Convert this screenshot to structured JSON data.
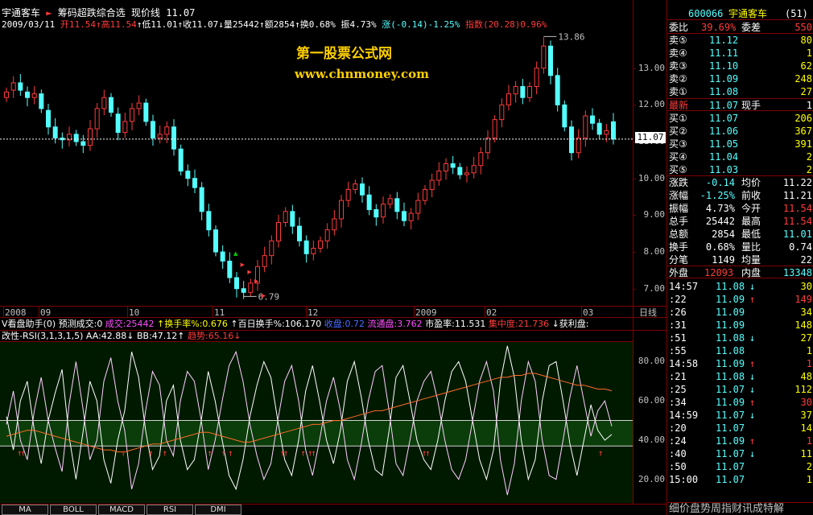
{
  "header": {
    "stock_name": "宇通客车",
    "indicator_name": "筹码超跌综合选",
    "line_type": "现价线",
    "line_value": "11.07",
    "date": "2009/03/11",
    "open": "开11.54",
    "high": "高11.54",
    "low": "低11.01",
    "close": "收11.07",
    "volume": "量25442",
    "amount": "额2854",
    "turnover": "换0.68%",
    "amplitude": "振4.73%",
    "change": "涨(-0.14)-1.25%",
    "index": "指数(20.28)0.96%"
  },
  "watermark": {
    "title": "第一股票公式网",
    "url": "www.chnmoney.com"
  },
  "chart_data": [
    {
      "type": "candlestick",
      "title": "",
      "ylim": [
        6.6,
        14.0
      ],
      "y_ticks": [
        "13.00",
        "12.00",
        "11.00",
        "10.00",
        "9.00",
        "8.00",
        "7.00"
      ],
      "x_ticks": [
        "2008",
        "09",
        "10",
        "11",
        "12",
        "2009",
        "02",
        "03"
      ],
      "period": "日线",
      "annotations": [
        {
          "label": "13.86",
          "value": 13.86
        },
        {
          "label": "6.79",
          "value": 6.79
        }
      ],
      "current_price": {
        "label": "11.07",
        "value": 11.07
      },
      "close": [
        12.35,
        12.6,
        12.4,
        12.2,
        12.3,
        11.9,
        11.4,
        11.1,
        11.05,
        11.2,
        11.0,
        10.9,
        11.35,
        11.9,
        12.2,
        11.8,
        11.25,
        11.55,
        11.9,
        12.05,
        11.55,
        11.1,
        11.2,
        11.4,
        10.8,
        10.2,
        10.0,
        9.75,
        9.1,
        8.6,
        8.0,
        7.75,
        7.3,
        7.0,
        6.9,
        7.15,
        7.6,
        7.9,
        8.3,
        8.8,
        9.1,
        8.7,
        8.3,
        7.95,
        8.1,
        8.3,
        8.6,
        8.9,
        9.4,
        9.7,
        9.85,
        9.55,
        9.15,
        8.95,
        9.3,
        9.45,
        9.1,
        8.85,
        9.05,
        9.4,
        9.7,
        9.95,
        10.2,
        10.4,
        10.3,
        10.1,
        10.15,
        10.35,
        10.7,
        11.1,
        11.6,
        12.0,
        12.3,
        12.5,
        12.2,
        12.5,
        13.0,
        13.6,
        12.8,
        12.0,
        11.4,
        10.7,
        11.1,
        11.7,
        11.5,
        11.2,
        11.3,
        11.07
      ],
      "open": [
        12.2,
        12.4,
        12.6,
        12.35,
        12.2,
        12.3,
        11.85,
        11.4,
        11.1,
        11.05,
        11.2,
        11.0,
        10.9,
        11.35,
        11.9,
        12.2,
        11.75,
        11.25,
        11.55,
        11.9,
        12.05,
        11.55,
        11.1,
        11.2,
        11.4,
        10.8,
        10.2,
        10.0,
        9.75,
        9.1,
        8.6,
        8.0,
        7.75,
        7.3,
        7.0,
        6.9,
        7.15,
        7.6,
        7.9,
        8.3,
        8.8,
        9.1,
        8.7,
        8.3,
        7.95,
        8.1,
        8.3,
        8.6,
        8.9,
        9.4,
        9.7,
        9.85,
        9.55,
        9.15,
        8.95,
        9.3,
        9.45,
        9.1,
        8.85,
        9.05,
        9.4,
        9.7,
        9.95,
        10.2,
        10.4,
        10.3,
        10.1,
        10.15,
        10.35,
        10.7,
        11.1,
        11.6,
        12.0,
        12.3,
        12.5,
        12.2,
        12.5,
        13.0,
        13.6,
        12.8,
        12.0,
        11.4,
        10.7,
        11.1,
        11.7,
        11.5,
        11.2,
        11.54
      ]
    },
    {
      "type": "line",
      "title": "改性-RSI(3,1,3,1,5)",
      "ylim": [
        8,
        90
      ],
      "y_ticks": [
        "80.00",
        "60.00",
        "40.00",
        "20.00"
      ],
      "band": [
        37,
        50
      ],
      "legend_text": [
        "AA:42.88↓",
        "BB:47.12↑",
        "趋势:65.16↓"
      ],
      "series": [
        {
          "name": "AA",
          "values": [
            52,
            35,
            60,
            70,
            45,
            28,
            50,
            64,
            76,
            42,
            20,
            44,
            70,
            60,
            30,
            18,
            40,
            55,
            85,
            72,
            45,
            25,
            32,
            60,
            68,
            40,
            25,
            30,
            50,
            75,
            60,
            40,
            22,
            15,
            30,
            52,
            68,
            80,
            72,
            50,
            30,
            22,
            40,
            65,
            78,
            60,
            40,
            28,
            45,
            70,
            80,
            62,
            40,
            25,
            22,
            45,
            72,
            78,
            60,
            40,
            30,
            25,
            40,
            60,
            75,
            80,
            70,
            50,
            30,
            20,
            35,
            70,
            88,
            72,
            40,
            20,
            30,
            60,
            78,
            80,
            60,
            38,
            22,
            40,
            58,
            45,
            40,
            42.88
          ]
        },
        {
          "name": "BB",
          "values": [
            48,
            65,
            40,
            30,
            55,
            72,
            50,
            36,
            24,
            58,
            80,
            56,
            30,
            40,
            70,
            82,
            60,
            45,
            15,
            28,
            55,
            75,
            68,
            40,
            32,
            60,
            75,
            70,
            50,
            25,
            40,
            60,
            78,
            85,
            70,
            48,
            32,
            20,
            28,
            50,
            70,
            78,
            60,
            35,
            22,
            40,
            60,
            72,
            55,
            30,
            20,
            38,
            60,
            75,
            78,
            55,
            28,
            22,
            40,
            60,
            70,
            75,
            60,
            40,
            25,
            20,
            30,
            50,
            70,
            80,
            65,
            30,
            12,
            28,
            60,
            80,
            70,
            40,
            22,
            20,
            40,
            62,
            78,
            60,
            42,
            55,
            60,
            47.12
          ]
        },
        {
          "name": "趋势",
          "values": [
            42,
            43,
            44,
            45,
            45,
            44,
            43,
            42,
            41,
            40,
            39,
            38,
            37,
            36,
            35,
            35,
            34,
            34,
            35,
            36,
            37,
            38,
            38,
            39,
            40,
            41,
            42,
            43,
            44,
            44,
            43,
            42,
            41,
            40,
            39,
            39,
            40,
            41,
            42,
            43,
            44,
            45,
            46,
            47,
            48,
            48,
            49,
            50,
            50,
            51,
            52,
            53,
            54,
            55,
            55,
            56,
            57,
            58,
            59,
            60,
            61,
            62,
            63,
            64,
            65,
            66,
            67,
            68,
            69,
            70,
            71,
            72,
            72,
            73,
            73,
            74,
            74,
            73,
            72,
            71,
            70,
            69,
            68,
            68,
            67,
            66,
            66,
            65.16
          ]
        }
      ],
      "signal_positions": [
        3,
        4,
        33,
        41,
        45,
        58,
        62,
        64,
        79,
        80,
        85,
        87,
        88,
        120,
        121,
        171
      ]
    }
  ],
  "vol_bar": {
    "prefix": "V看盘助手(0)",
    "predict": "预测成交:0",
    "volume": "成交:25442",
    "turnover": "↑换手率%:0.676",
    "hundred": "↑百日换手%:106.170",
    "flow": "流通盘:3.762",
    "pe": "市盈率:11.531",
    "conc": "集中度:21.736",
    "profit": "↓获利盘:",
    "hidden": "收盘:0.72"
  },
  "tabs": [
    "MA",
    "BOLL",
    "MACD",
    "RSI",
    "DMI"
  ],
  "quote": {
    "code": "600066",
    "name": "宇通客车",
    "num": "(51)",
    "weibi_label": "委比",
    "weibi_value": "39.69%",
    "weicha_label": "委差",
    "weicha_value": "550",
    "sell": [
      {
        "label": "卖⑤",
        "price": "11.12",
        "vol": "80"
      },
      {
        "label": "卖④",
        "price": "11.11",
        "vol": "1"
      },
      {
        "label": "卖③",
        "price": "11.10",
        "vol": "62"
      },
      {
        "label": "卖②",
        "price": "11.09",
        "vol": "248"
      },
      {
        "label": "卖①",
        "price": "11.08",
        "vol": "27"
      }
    ],
    "last_label": "最新",
    "last_price": "11.07",
    "hand_label": "现手",
    "hand_value": "1",
    "buy": [
      {
        "label": "买①",
        "price": "11.07",
        "vol": "206"
      },
      {
        "label": "买②",
        "price": "11.06",
        "vol": "367"
      },
      {
        "label": "买③",
        "price": "11.05",
        "vol": "391"
      },
      {
        "label": "买④",
        "price": "11.04",
        "vol": "2"
      },
      {
        "label": "买⑤",
        "price": "11.03",
        "vol": "2"
      }
    ],
    "stats": [
      {
        "l1": "涨跌",
        "v1": "-0.14",
        "l2": "均价",
        "v2": "11.22"
      },
      {
        "l1": "涨幅",
        "v1": "-1.25%",
        "l2": "前收",
        "v2": "11.21"
      },
      {
        "l1": "振幅",
        "v1": "4.73%",
        "l2": "今开",
        "v2": "11.54"
      },
      {
        "l1": "总手",
        "v1": "25442",
        "l2": "最高",
        "v2": "11.54"
      },
      {
        "l1": "总额",
        "v1": "2854",
        "l2": "最低",
        "v2": "11.01"
      },
      {
        "l1": "换手",
        "v1": "0.68%",
        "l2": "量比",
        "v2": "0.74"
      },
      {
        "l1": "分笔",
        "v1": "1149",
        "l2": "均量",
        "v2": "22"
      }
    ],
    "outer_label": "外盘",
    "outer_value": "12093",
    "inner_label": "内盘",
    "inner_value": "13348",
    "ticks": [
      {
        "t": "14:57",
        "p": "11.08",
        "d": "↓",
        "v": "30"
      },
      {
        "t": ":22",
        "p": "11.09",
        "d": "↑",
        "v": "149"
      },
      {
        "t": ":26",
        "p": "11.09",
        "d": "",
        "v": "34"
      },
      {
        "t": ":31",
        "p": "11.09",
        "d": "",
        "v": "148"
      },
      {
        "t": ":51",
        "p": "11.08",
        "d": "↓",
        "v": "27"
      },
      {
        "t": ":55",
        "p": "11.08",
        "d": "",
        "v": "1"
      },
      {
        "t": "14:58",
        "p": "11.09",
        "d": "↑",
        "v": "1"
      },
      {
        "t": ":21",
        "p": "11.08",
        "d": "↓",
        "v": "48"
      },
      {
        "t": ":25",
        "p": "11.07",
        "d": "↓",
        "v": "112"
      },
      {
        "t": ":34",
        "p": "11.09",
        "d": "↑",
        "v": "30"
      },
      {
        "t": "14:59",
        "p": "11.07",
        "d": "↓",
        "v": "37"
      },
      {
        "t": ":20",
        "p": "11.07",
        "d": "",
        "v": "14"
      },
      {
        "t": ":24",
        "p": "11.09",
        "d": "↑",
        "v": "1"
      },
      {
        "t": ":40",
        "p": "11.07",
        "d": "↓",
        "v": "11"
      },
      {
        "t": ":50",
        "p": "11.07",
        "d": "",
        "v": "2"
      },
      {
        "t": "15:00",
        "p": "11.07",
        "d": "",
        "v": "1"
      }
    ],
    "bottom_tabs": "细价盘势周指财讯成特解"
  },
  "colors": {
    "up": "#ff3b3b",
    "down": "#54ffff",
    "frame": "#800000",
    "band": "#0a3d0a"
  }
}
